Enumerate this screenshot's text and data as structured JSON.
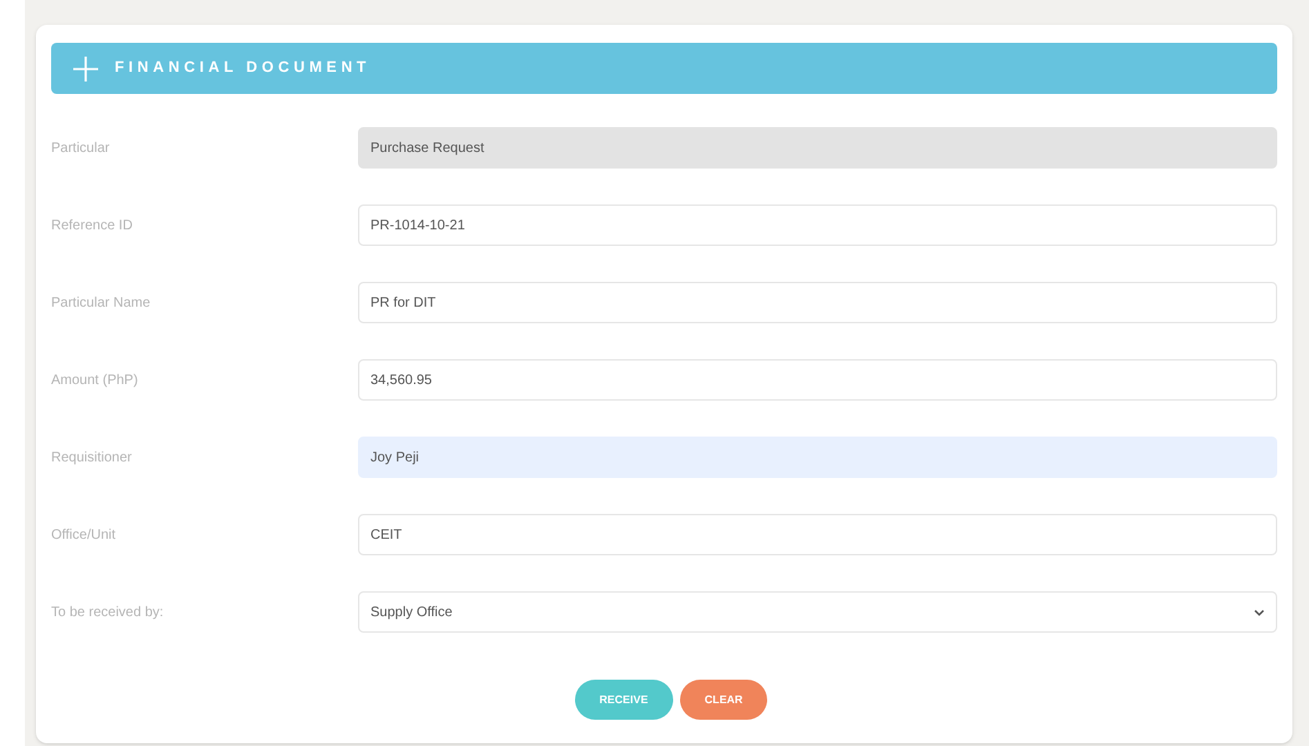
{
  "header": {
    "title": "FINANCIAL DOCUMENT"
  },
  "fields": [
    {
      "label": "Particular",
      "value": "Purchase Request",
      "kind": "readonly"
    },
    {
      "label": "Reference ID",
      "value": "PR-1014-10-21",
      "kind": "text"
    },
    {
      "label": "Particular Name",
      "value": "PR for DIT",
      "kind": "text"
    },
    {
      "label": "Amount (PhP)",
      "value": "34,560.95",
      "kind": "text"
    },
    {
      "label": "Requisitioner",
      "value": "Joy Peji",
      "kind": "autofill"
    },
    {
      "label": "Office/Unit",
      "value": "CEIT",
      "kind": "text"
    },
    {
      "label": "To be received by:",
      "value": "Supply Office",
      "kind": "select"
    }
  ],
  "buttons": [
    {
      "label": "RECEIVE",
      "kind": "primary"
    },
    {
      "label": "CLEAR",
      "kind": "secondary"
    }
  ]
}
